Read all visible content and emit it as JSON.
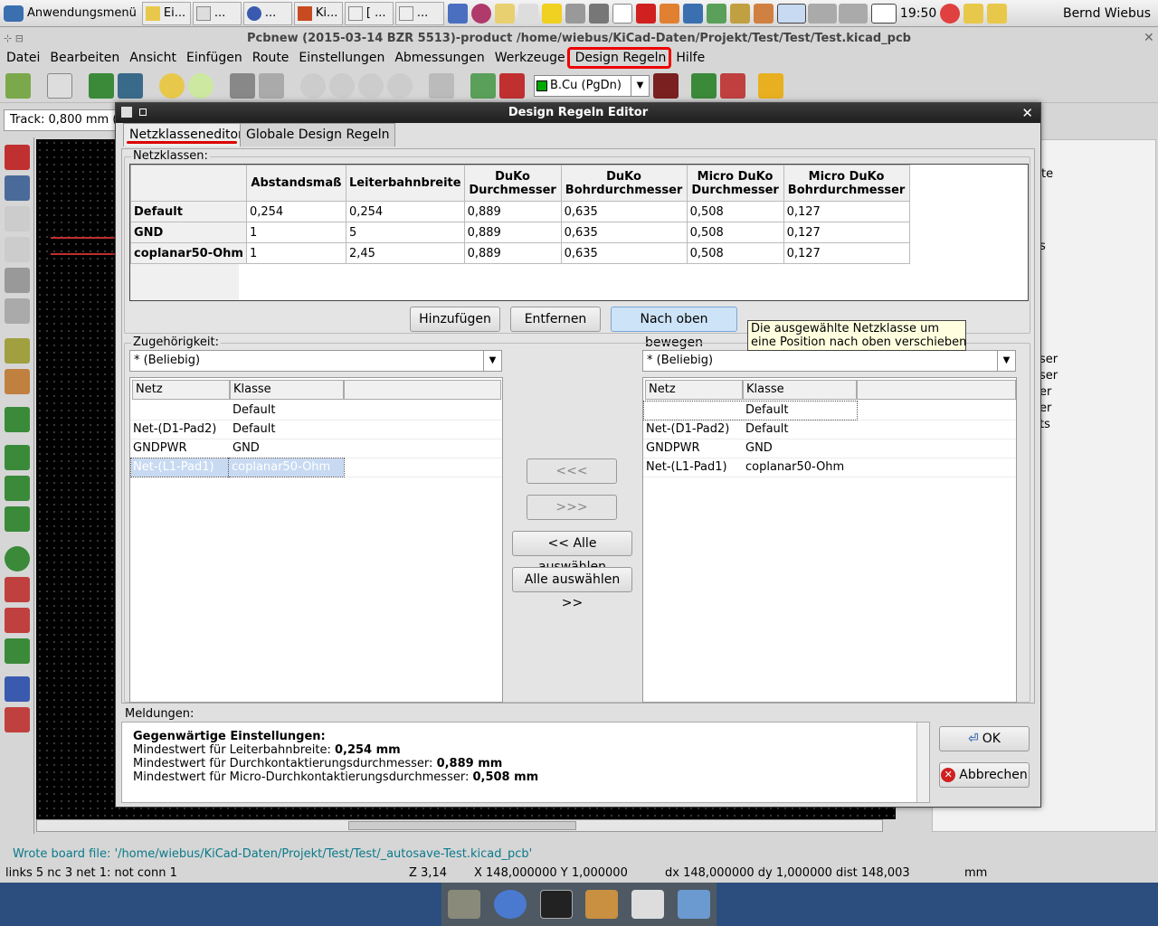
{
  "taskbar": {
    "start_label": "Anwendungsmenü",
    "tasks": [
      "Ei...",
      "...",
      "...",
      "Ki...",
      "[ ...",
      "..."
    ],
    "clock": "19:50",
    "user": "Bernd Wiebus"
  },
  "window": {
    "title": "Pcbnew (2015-03-14 BZR 5513)-product /home/wiebus/KiCad-Daten/Projekt/Test/Test/Test.kicad_pcb",
    "menu": [
      "Datei",
      "Bearbeiten",
      "Ansicht",
      "Einfügen",
      "Route",
      "Einstellungen",
      "Abmessungen",
      "Werkzeuge",
      "Design Regeln",
      "Hilfe"
    ],
    "layer_select": "B.Cu (PgDn)",
    "track_width": "Track: 0,800 mm (",
    "status_message": "Wrote board file: '/home/wiebus/KiCad-Daten/Projekt/Test/Test/_autosave-Test.kicad_pcb'",
    "status": {
      "links": "links 5 nc 3  net 1: not conn 1",
      "zoom": "Z 3,14",
      "xy": "X 148,000000  Y 1,000000",
      "delta": "dx 148,000000 dy 1,000000 dist 148,003",
      "unit": "mm"
    },
    "right_panel_fragments": [
      "te",
      "s",
      "ser",
      "ser",
      "er",
      "er",
      "ts"
    ]
  },
  "dialog": {
    "title": "Design Regeln Editor",
    "tabs": [
      "Netzklasseneditor",
      "Globale Design Regeln"
    ],
    "netclasses_label": "Netzklassen:",
    "netclass_headers": [
      "Abstandsmaß",
      "Leiterbahnbreite",
      "DuKo\nDurchmesser",
      "DuKo\nBohrdurchmesser",
      "Micro DuKo\nDurchmesser",
      "Micro DuKo\nBohrdurchmesser"
    ],
    "netclass_rows": [
      {
        "name": "Default",
        "values": [
          "0,254",
          "0,254",
          "0,889",
          "0,635",
          "0,508",
          "0,127"
        ]
      },
      {
        "name": "GND",
        "values": [
          "1",
          "5",
          "0,889",
          "0,635",
          "0,508",
          "0,127"
        ]
      },
      {
        "name": "coplanar50-Ohm",
        "values": [
          "1",
          "2,45",
          "0,889",
          "0,635",
          "0,508",
          "0,127"
        ]
      }
    ],
    "buttons": {
      "add": "Hinzufügen",
      "remove": "Entfernen",
      "move_up": "Nach oben bewegen"
    },
    "tooltip": "Die ausgewählte Netzklasse um\neine Position nach oben verschieben",
    "membership_label": "Zugehörigkeit:",
    "left_filter": "* (Beliebig)",
    "right_filter": "* (Beliebig)",
    "list_headers": [
      "Netz",
      "Klasse"
    ],
    "left_rows": [
      {
        "net": "",
        "class": "Default"
      },
      {
        "net": "Net-(D1-Pad2)",
        "class": "Default"
      },
      {
        "net": "GNDPWR",
        "class": "GND"
      },
      {
        "net": "Net-(L1-Pad1)",
        "class": "coplanar50-Ohm"
      }
    ],
    "right_rows": [
      {
        "net": "",
        "class": "Default"
      },
      {
        "net": "Net-(D1-Pad2)",
        "class": "Default"
      },
      {
        "net": "GNDPWR",
        "class": "GND"
      },
      {
        "net": "Net-(L1-Pad1)",
        "class": "coplanar50-Ohm"
      }
    ],
    "move_buttons": {
      "left": "<<<",
      "right": ">>>",
      "select_all_left": "<< Alle auswählen",
      "select_all_right": "Alle auswählen >>"
    },
    "messages_label": "Meldungen:",
    "messages": {
      "heading": "Gegenwärtige Einstellungen:",
      "line1_label": "Mindestwert für Leiterbahnbreite: ",
      "line1_value": "0,254 mm",
      "line2_label": "Mindestwert für Durchkontaktierungsdurchmesser: ",
      "line2_value": "0,889 mm",
      "line3_label": "Mindestwert für Micro-Durchkontaktierungsdurchmesser: ",
      "line3_value": "0,508 mm"
    },
    "ok": "OK",
    "cancel": "Abbrechen"
  },
  "colors": {
    "highlight": "#e00000",
    "titlebar": "#262626",
    "selection": "#c8daf2"
  }
}
